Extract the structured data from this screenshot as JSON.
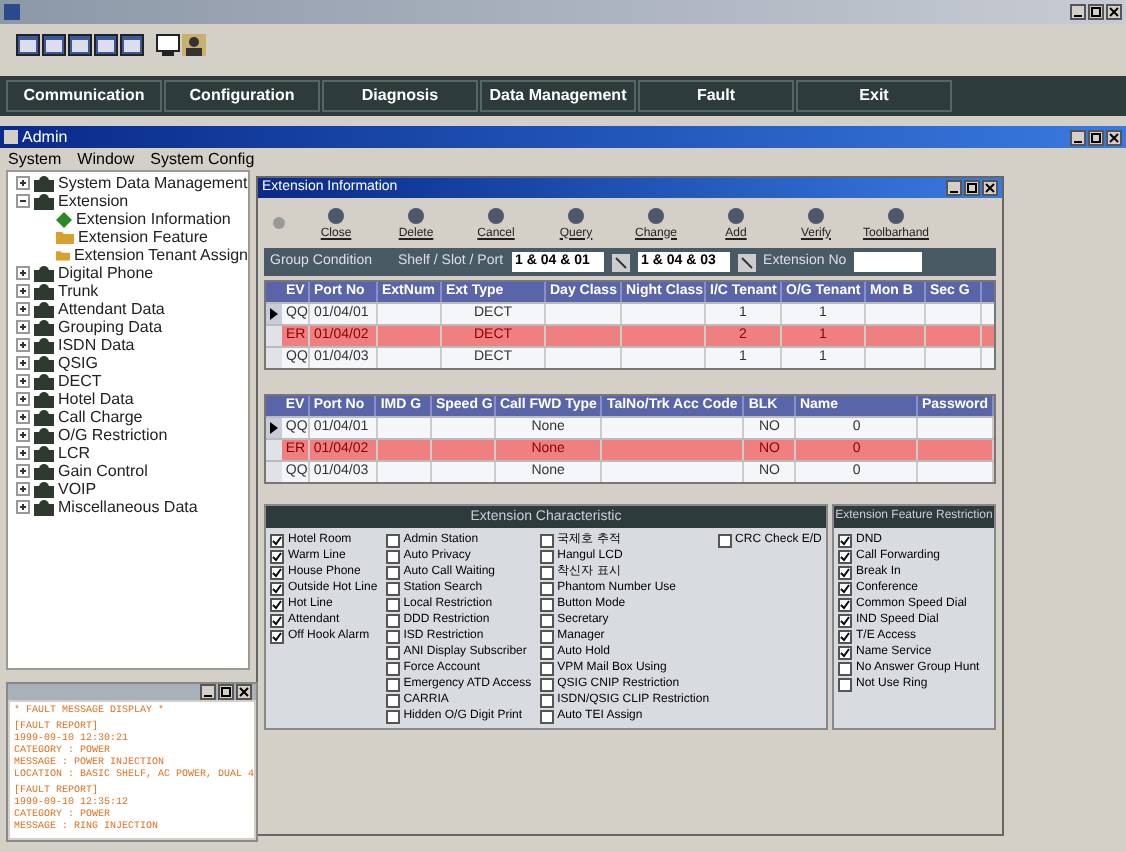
{
  "nav": [
    "Communication",
    "Configuration",
    "Diagnosis",
    "Data Management",
    "Fault",
    "Exit"
  ],
  "admin": {
    "title": "Admin",
    "menu": [
      "System",
      "Window",
      "System Config"
    ]
  },
  "tree": [
    {
      "label": "System Data Management",
      "expanded": false
    },
    {
      "label": "Extension",
      "expanded": true,
      "children": [
        {
          "label": "Extension Information",
          "kind": "leaf"
        },
        {
          "label": "Extension Feature",
          "kind": "folder"
        },
        {
          "label": "Extension Tenant Assign",
          "kind": "folder"
        }
      ]
    },
    {
      "label": "Digital Phone",
      "expanded": false
    },
    {
      "label": "Trunk",
      "expanded": false
    },
    {
      "label": "Attendant Data",
      "expanded": false
    },
    {
      "label": "Grouping Data",
      "expanded": false
    },
    {
      "label": "ISDN Data",
      "expanded": false
    },
    {
      "label": "QSIG",
      "expanded": false
    },
    {
      "label": "DECT",
      "expanded": false
    },
    {
      "label": "Hotel Data",
      "expanded": false
    },
    {
      "label": "Call Charge",
      "expanded": false
    },
    {
      "label": "O/G Restriction",
      "expanded": false
    },
    {
      "label": "LCR",
      "expanded": false
    },
    {
      "label": "Gain Control",
      "expanded": false
    },
    {
      "label": "VOIP",
      "expanded": false
    },
    {
      "label": "Miscellaneous Data",
      "expanded": false
    }
  ],
  "ext_window": {
    "title": "Extension Information",
    "toolbar": [
      {
        "label": "Close",
        "disabled": false
      },
      {
        "label": "Delete",
        "disabled": false
      },
      {
        "label": "Cancel",
        "disabled": false
      },
      {
        "label": "Query",
        "disabled": false
      },
      {
        "label": "Change",
        "disabled": false
      },
      {
        "label": "Add",
        "disabled": false
      },
      {
        "label": "Verify",
        "disabled": false
      },
      {
        "label": "Toolbarhand",
        "disabled": false
      }
    ],
    "condition": {
      "label": "Group Condition",
      "range_label": "Shelf / Slot / Port",
      "from": "1 & 04 & 01",
      "to": "1 & 04 & 03",
      "ext_label": "Extension No"
    },
    "grid_1": {
      "columns": [
        "EV",
        "Port No",
        "ExtNum",
        "Ext Type",
        "Day Class",
        "Night Class",
        "I/C Tenant",
        "O/G Tenant",
        "Mon B",
        "Sec G"
      ],
      "rows": [
        {
          "current": true,
          "highlighted": false,
          "cells": [
            "QQ",
            "01/04/01",
            null,
            "DECT",
            null,
            null,
            "1",
            "1",
            null,
            null
          ]
        },
        {
          "current": false,
          "highlighted": true,
          "cells": [
            "ER",
            "01/04/02",
            null,
            "DECT",
            null,
            null,
            "2",
            "1",
            null,
            null
          ]
        },
        {
          "current": false,
          "highlighted": false,
          "cells": [
            "QQ",
            "01/04/03",
            null,
            "DECT",
            null,
            null,
            "1",
            "1",
            null,
            null
          ]
        }
      ]
    },
    "grid_2": {
      "columns": [
        "EV",
        "Port No",
        "IMD G",
        "Speed G",
        "Call FWD Type",
        "TalNo/Trk Acc Code",
        "BLK",
        "Name",
        "Password"
      ],
      "rows": [
        {
          "current": true,
          "highlighted": false,
          "cells": [
            "QQ",
            "01/04/01",
            null,
            null,
            "None",
            null,
            "NO",
            "0",
            null
          ]
        },
        {
          "current": false,
          "highlighted": true,
          "cells": [
            "ER",
            "01/04/02",
            null,
            null,
            "None",
            null,
            "NO",
            "0",
            null
          ]
        },
        {
          "current": false,
          "highlighted": false,
          "cells": [
            "QQ",
            "01/04/03",
            null,
            null,
            "None",
            null,
            "NO",
            "0",
            null
          ]
        }
      ]
    },
    "characteristics": {
      "title": "Extension Characteristic",
      "columns": [
        [
          {
            "label": "Hotel Room",
            "checked": true
          },
          {
            "label": "Warm Line",
            "checked": true
          },
          {
            "label": "House Phone",
            "checked": true
          },
          {
            "label": "Outside Hot Line",
            "checked": true
          },
          {
            "label": "Hot Line",
            "checked": true
          },
          {
            "label": "Attendant",
            "checked": true
          },
          {
            "label": "Off Hook Alarm",
            "checked": true
          }
        ],
        [
          {
            "label": "Admin Station",
            "checked": false
          },
          {
            "label": "Auto Privacy",
            "checked": false
          },
          {
            "label": "Auto Call Waiting",
            "checked": false
          },
          {
            "label": "Station Search",
            "checked": false
          },
          {
            "label": "Local Restriction",
            "checked": false
          },
          {
            "label": "DDD Restriction",
            "checked": false
          },
          {
            "label": "ISD Restriction",
            "checked": false
          },
          {
            "label": "ANI Display Subscriber",
            "checked": false
          },
          {
            "label": "Force Account",
            "checked": false
          },
          {
            "label": "Emergency ATD Access",
            "checked": false
          },
          {
            "label": "CARRIA",
            "checked": false
          },
          {
            "label": "Hidden O/G Digit Print",
            "checked": false
          }
        ],
        [
          {
            "label": "국제호 추적",
            "checked": false
          },
          {
            "label": "Hangul LCD",
            "checked": false
          },
          {
            "label": "착신자 표시",
            "checked": false
          },
          {
            "label": "Phantom Number Use",
            "checked": false
          },
          {
            "label": "Button Mode",
            "checked": false
          },
          {
            "label": "Secretary",
            "checked": false
          },
          {
            "label": "Manager",
            "checked": false
          },
          {
            "label": "Auto Hold",
            "checked": false
          },
          {
            "label": "VPM Mail Box Using",
            "checked": false
          },
          {
            "label": "QSIG CNIP Restriction",
            "checked": false
          },
          {
            "label": "ISDN/QSIG CLIP Restriction",
            "checked": false
          },
          {
            "label": "Auto TEI Assign",
            "checked": false
          }
        ],
        [
          {
            "label": "CRC Check E/D",
            "checked": false
          }
        ]
      ]
    },
    "restriction": {
      "title": "Extension Feature Restriction",
      "items": [
        {
          "label": "DND",
          "checked": true
        },
        {
          "label": "Call Forwarding",
          "checked": true
        },
        {
          "label": "Break In",
          "checked": true
        },
        {
          "label": "Conference",
          "checked": true
        },
        {
          "label": "Common Speed Dial",
          "checked": true
        },
        {
          "label": "IND Speed Dial",
          "checked": true
        },
        {
          "label": "T/E Access",
          "checked": true
        },
        {
          "label": "Name Service",
          "checked": true
        },
        {
          "label": "No Answer Group Hunt",
          "checked": false
        },
        {
          "label": "Not Use Ring",
          "checked": false
        }
      ]
    }
  },
  "fault_window": {
    "lines": [
      "* FAULT MESSAGE DISPLAY *",
      "[FAULT REPORT]",
      "1999-09-10 12:30:21",
      "CATEGORY : POWER",
      "MESSAGE : POWER INJECTION",
      "LOCATION : BASIC SHELF, AC POWER, DUAL 4",
      "[FAULT REPORT]",
      "1999-09-10 12:35:12",
      "CATEGORY : POWER",
      "MESSAGE : RING INJECTION"
    ]
  }
}
